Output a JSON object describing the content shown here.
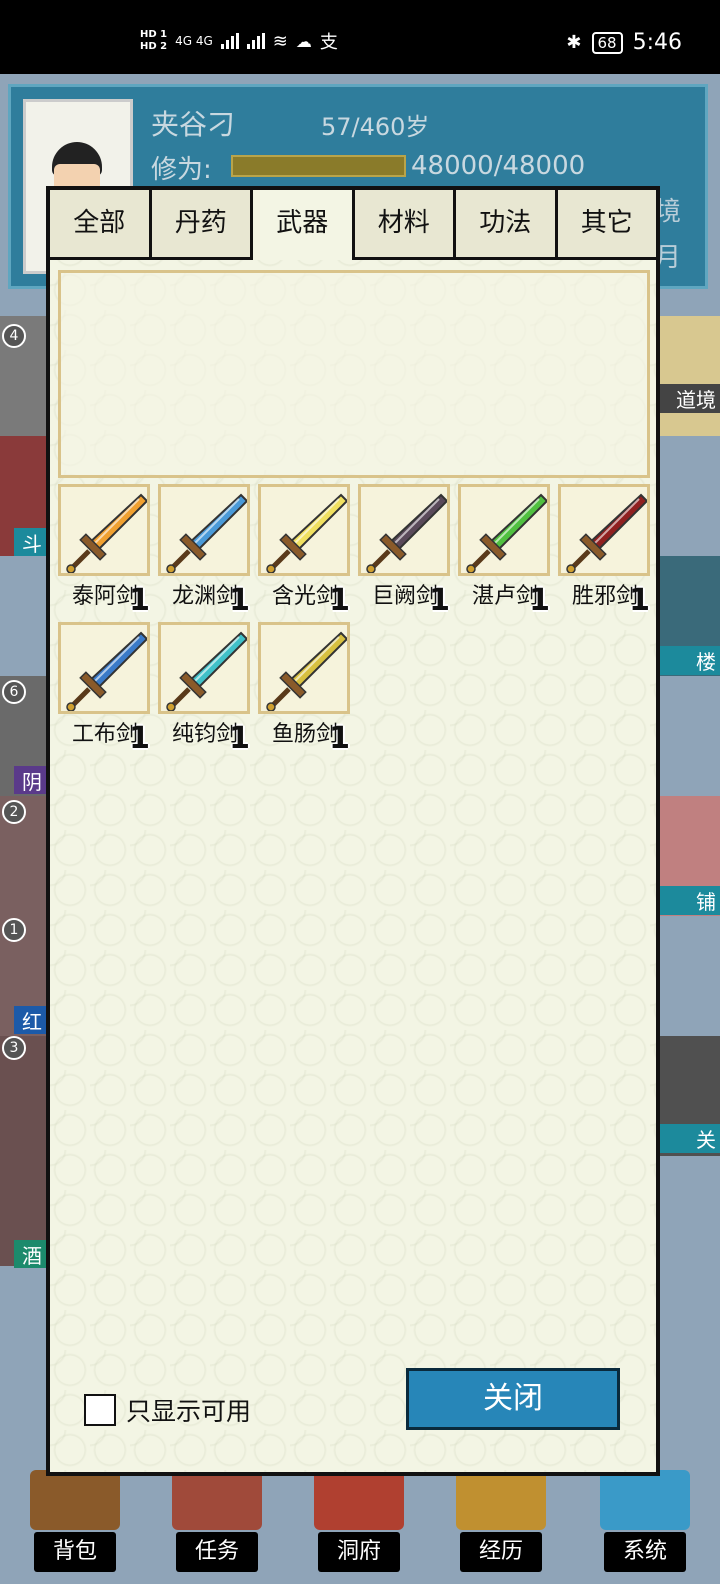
{
  "status_bar": {
    "left_indicators": "4G 4G",
    "hd_labels": [
      "HD 1",
      "HD 2"
    ],
    "app_icons": [
      "wifi-icon",
      "wechat-icon",
      "alipay-icon"
    ],
    "battery": "68",
    "time": "5:46",
    "wechat_glyph": "☁",
    "alipay_glyph": "支",
    "wifi_glyph": "≋",
    "bluetooth_glyph": "✱"
  },
  "player": {
    "name": "夹谷刁",
    "age": "57/460岁",
    "xiuwei_label": "修为:",
    "xiuwei_value": "48000/48000",
    "xiuwei_fill": 1.0,
    "realm_suffix": "境",
    "month_suffix": "月"
  },
  "left_tiles": [
    {
      "num": "4",
      "label": ""
    },
    {
      "num": "",
      "label": "斗"
    },
    {
      "num": "6",
      "label": ""
    },
    {
      "num": "",
      "label": "阴"
    },
    {
      "num": "2",
      "label": ""
    },
    {
      "num": "1",
      "label": ""
    },
    {
      "num": "",
      "label": "红"
    },
    {
      "num": "3",
      "label": ""
    },
    {
      "num": "",
      "label": "酒"
    }
  ],
  "right_tiles": [
    {
      "label": "道境"
    },
    {
      "label": "楼"
    },
    {
      "label": "铺"
    },
    {
      "label": "关"
    }
  ],
  "bottom_nav": [
    "背包",
    "任务",
    "洞府",
    "经历",
    "系统"
  ],
  "inventory": {
    "tabs": [
      "全部",
      "丹药",
      "武器",
      "材料",
      "功法",
      "其它"
    ],
    "active_tab": "武器",
    "items": [
      {
        "name": "泰阿剑",
        "count": "1",
        "color": "#f0a030"
      },
      {
        "name": "龙渊剑",
        "count": "1",
        "color": "#4a9ad8"
      },
      {
        "name": "含光剑",
        "count": "1",
        "color": "#f0e060"
      },
      {
        "name": "巨阙剑",
        "count": "1",
        "color": "#5a4a5a"
      },
      {
        "name": "湛卢剑",
        "count": "1",
        "color": "#50c040"
      },
      {
        "name": "胜邪剑",
        "count": "1",
        "color": "#902020"
      },
      {
        "name": "工布剑",
        "count": "1",
        "color": "#3a7ac8"
      },
      {
        "name": "纯钧剑",
        "count": "1",
        "color": "#40c0c8"
      },
      {
        "name": "鱼肠剑",
        "count": "1",
        "color": "#d8c040"
      }
    ],
    "filter_label": "只显示可用",
    "filter_checked": false,
    "close_label": "关闭"
  },
  "colors": {
    "accent": "#2786b8",
    "panel_bg": "#f3f5e4",
    "item_border": "#d9c38a"
  }
}
